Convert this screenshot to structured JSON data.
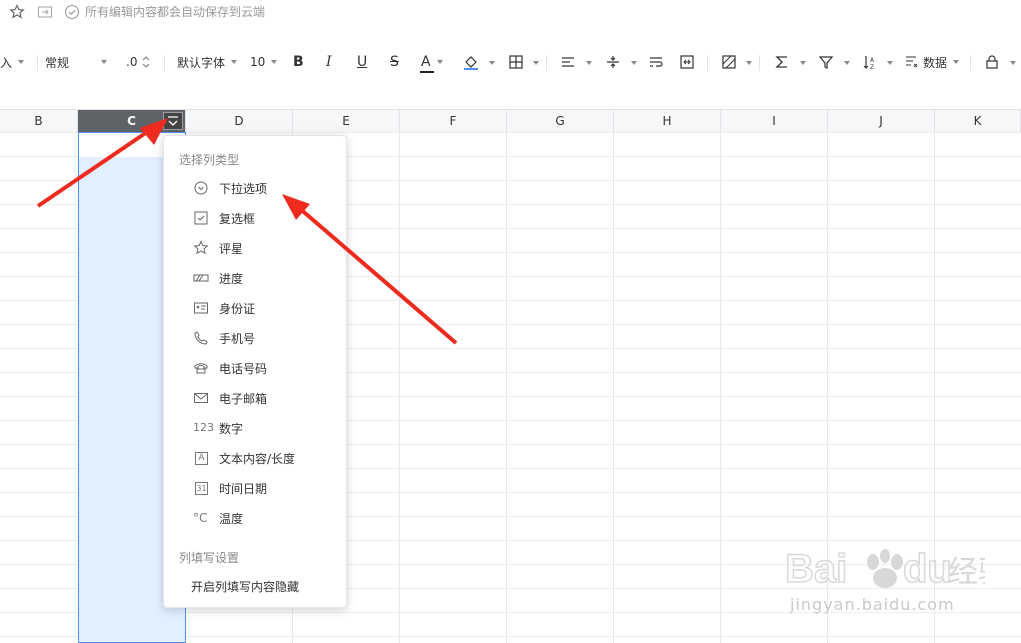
{
  "topbar": {
    "save_status": "所有编辑内容都会自动保存到云端"
  },
  "toolbar": {
    "insert_partial": "入",
    "format": "常规",
    "decimal": ".0",
    "font": "默认字体",
    "font_size": "10",
    "bold": "B",
    "italic": "I",
    "underline": "U",
    "strikethrough": "S",
    "text_color_glyph": "A",
    "data_menu": "数据",
    "colors": {
      "text_color_bar": "#222222",
      "fill_color_bar": "#4d8ff0"
    }
  },
  "columns": [
    "B",
    "C",
    "D",
    "E",
    "F",
    "G",
    "H",
    "I",
    "J",
    "K"
  ],
  "selected_column": "C",
  "menu": {
    "section1": "选择列类型",
    "items": [
      {
        "label": "下拉选项",
        "icon": "dropdown-circle-icon"
      },
      {
        "label": "复选框",
        "icon": "checkbox-icon"
      },
      {
        "label": "评星",
        "icon": "star-icon"
      },
      {
        "label": "进度",
        "icon": "progress-icon"
      },
      {
        "label": "身份证",
        "icon": "id-card-icon"
      },
      {
        "label": "手机号",
        "icon": "phone-icon"
      },
      {
        "label": "电话号码",
        "icon": "telephone-icon"
      },
      {
        "label": "电子邮箱",
        "icon": "mail-icon"
      },
      {
        "label": "数字",
        "icon": "number-icon",
        "icon_text": "123"
      },
      {
        "label": "文本内容/长度",
        "icon": "text-length-icon",
        "icon_text": "A"
      },
      {
        "label": "时间日期",
        "icon": "calendar-icon",
        "icon_text": "31"
      },
      {
        "label": "温度",
        "icon": "temperature-icon",
        "icon_text": "°C"
      }
    ],
    "section2": "列填写设置",
    "footer_item": "开启列填写内容隐藏"
  },
  "watermark": {
    "brand_latin": "Bai",
    "brand_latin2": "du",
    "brand_cn": "经验",
    "site": "jingyan.baidu.com"
  },
  "annotation_color": "#ee2b1e"
}
